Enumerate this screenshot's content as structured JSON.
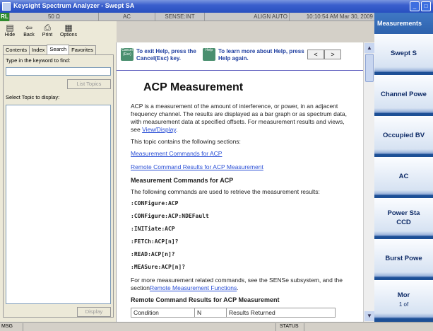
{
  "window": {
    "title": "Keysight Spectrum Analyzer - Swept SA"
  },
  "status_row": {
    "rf_indicator": "RL",
    "impedance": "50 Ω",
    "coupling": "AC",
    "sense": "SENSE:INT",
    "align": "ALIGN AUTO",
    "datetime": "10:10:54 AM Mar 30, 2009"
  },
  "toolbar": {
    "hide": "Hide",
    "back": "Back",
    "print": "Print",
    "options": "Options"
  },
  "help_nav": {
    "tabs": [
      "Contents",
      "Index",
      "Search",
      "Favorites"
    ],
    "keyword_label": "Type in the keyword to find:",
    "keyword_value": "",
    "list_topics": "List Topics",
    "select_topic": "Select Topic to display:",
    "display": "Display"
  },
  "help_header": {
    "cancel_key": "Cancel (Esc)",
    "help_key": "Help",
    "exit_hint": "To exit Help, press the Cancel(Esc) key.",
    "more_hint": "To learn more about Help, press Help again.",
    "prev": "<",
    "next": ">"
  },
  "help_content": {
    "title": "ACP Measurement",
    "intro": "ACP is a measurement of the amount of interference, or power, in an adjacent frequency channel. The results are displayed as a bar graph or as spectrum data, with measurement data at specified offsets. For measurement results and views, see",
    "intro_link": "View/Display",
    "intro_end": ".",
    "contains": "This topic contains the following sections:",
    "link1": "Measurement Commands for ACP",
    "link2": "Remote Command Results for ACP Measurement",
    "section1": "Measurement Commands for ACP",
    "section1_text": "The following commands are used to retrieve the measurement results:",
    "commands": [
      ":CONFigure:ACP",
      ":CONFigure:ACP:NDEFault",
      ":INITiate:ACP",
      ":FETCh:ACP[n]?",
      ":READ:ACP[n]?",
      ":MEASure:ACP[n]?"
    ],
    "more_info": "For more measurement related commands, see the SENSe subsystem, and the section",
    "more_info_link": "Remote Measurement Functions",
    "more_info_end": ".",
    "section2": "Remote Command Results for ACP Measurement",
    "table_headers": [
      "Condition",
      "N",
      "Results Returned"
    ]
  },
  "softkeys": {
    "header": "Measurements",
    "keys": [
      {
        "line1": "Swept S",
        "line2": ""
      },
      {
        "line1": "Channel Powe",
        "line2": ""
      },
      {
        "line1": "Occupied BV",
        "line2": ""
      },
      {
        "line1": "AC",
        "line2": ""
      },
      {
        "line1": "Power Sta",
        "line2": "CCD"
      },
      {
        "line1": "Burst Powe",
        "line2": ""
      },
      {
        "line1": "Mor",
        "line2": "1 of"
      }
    ]
  },
  "statusbar": {
    "msg": "MSG",
    "status": "STATUS"
  },
  "colors": {
    "softkey_panel": "#1c4f96",
    "title_bar": "#2850c0",
    "link": "#2a4fd6"
  }
}
